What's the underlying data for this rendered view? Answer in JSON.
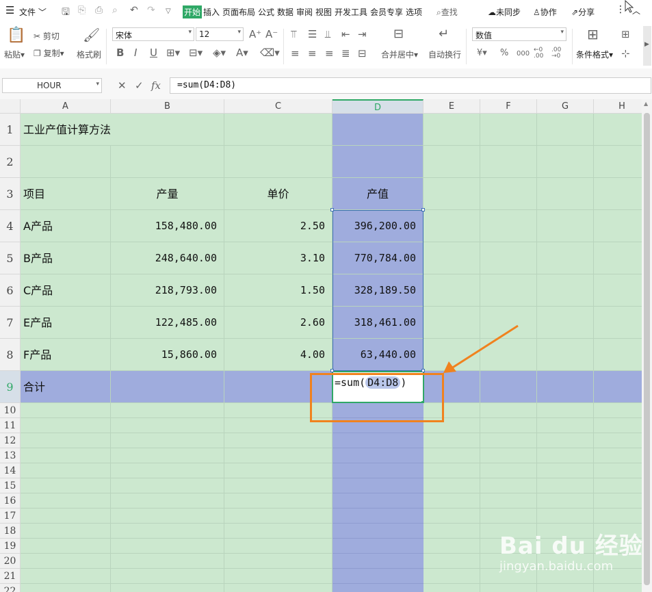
{
  "menubar": {
    "menu_icon": "hamburger-icon",
    "file_label": "文件",
    "tabs": [
      "开始",
      "插入",
      "页面布局",
      "公式",
      "数据",
      "审阅",
      "视图",
      "开发工具",
      "会员专享",
      "选项"
    ],
    "active_tab": "开始",
    "search_label": "查找",
    "unsynced_label": "未同步",
    "collab_label": "协作",
    "share_label": "分享"
  },
  "toolbar": {
    "paste_label": "粘贴",
    "cut_label": "剪切",
    "copy_label": "复制",
    "format_painter_label": "格式刷",
    "font_name": "宋体",
    "font_size": "12",
    "merge_label": "合并居中",
    "wrap_label": "自动换行",
    "number_format": "数值",
    "cond_format_label": "条件格式",
    "percent_symbol": "%",
    "thousands_symbol": "000",
    "yen_symbol": "¥"
  },
  "formula_bar": {
    "name_box": "HOUR",
    "cancel_icon": "close-icon",
    "confirm_icon": "check-icon",
    "fx_label": "fx",
    "formula": "=sum(D4:D8)"
  },
  "sheet": {
    "columns": [
      "A",
      "B",
      "C",
      "D",
      "E",
      "F",
      "G",
      "H"
    ],
    "selected_column": "D",
    "row_numbers": [
      "1",
      "2",
      "3",
      "4",
      "5",
      "6",
      "7",
      "8",
      "9",
      "10",
      "11",
      "12",
      "13",
      "14",
      "15",
      "16",
      "17",
      "18",
      "19",
      "20",
      "21",
      "22"
    ],
    "title": "工业产值计算方法",
    "headers": {
      "a": "项目",
      "b": "产量",
      "c": "单价",
      "d": "产值"
    },
    "rows": [
      {
        "a": "A产品",
        "b": "158,480.00",
        "c": "2.50",
        "d": "396,200.00"
      },
      {
        "a": "B产品",
        "b": "248,640.00",
        "c": "3.10",
        "d": "770,784.00"
      },
      {
        "a": "C产品",
        "b": "218,793.00",
        "c": "1.50",
        "d": "328,189.50"
      },
      {
        "a": "E产品",
        "b": "122,485.00",
        "c": "2.60",
        "d": "318,461.00"
      },
      {
        "a": "F产品",
        "b": "15,860.00",
        "c": "4.00",
        "d": "63,440.00"
      }
    ],
    "total_label": "合计",
    "edit_prefix": "=sum(",
    "edit_ref": "D4:D8",
    "edit_suffix": ")"
  },
  "watermark": {
    "logo": "Bai du 经验",
    "url": "jingyan.baidu.com"
  },
  "colors": {
    "accent": "#2fa866",
    "cell_bg": "#cce8cf",
    "selection": "#9facdd",
    "annotation": "#f0821e"
  }
}
